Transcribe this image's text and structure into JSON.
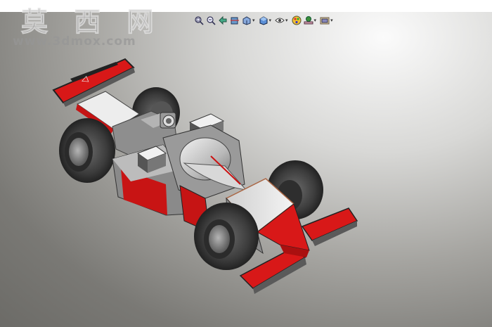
{
  "watermark": {
    "title": "莫 西 网",
    "url": "www.3dmox.com"
  },
  "toolbar": {
    "tools": [
      {
        "icon": "zoom-to-fit-icon",
        "has_dropdown": false
      },
      {
        "icon": "zoom-to-area-icon",
        "has_dropdown": false
      },
      {
        "icon": "previous-view-icon",
        "has_dropdown": false
      },
      {
        "icon": "section-view-icon",
        "has_dropdown": false
      },
      {
        "icon": "view-orientation-icon",
        "has_dropdown": true
      },
      {
        "icon": "display-style-icon",
        "has_dropdown": true
      },
      {
        "icon": "hide-show-items-icon",
        "has_dropdown": true
      },
      {
        "icon": "edit-appearance-icon",
        "has_dropdown": false
      },
      {
        "icon": "apply-scene-icon",
        "has_dropdown": true
      },
      {
        "icon": "view-settings-icon",
        "has_dropdown": true
      }
    ]
  },
  "scene": {
    "model": "formula-race-car",
    "colors": {
      "body_red": "#d81818",
      "body_white": "#e6e6e6",
      "body_grey": "#8a8a8a",
      "tire": "#3a3a3a",
      "background_light": "#fbfbfb",
      "background_dark": "#6c6b67"
    }
  }
}
